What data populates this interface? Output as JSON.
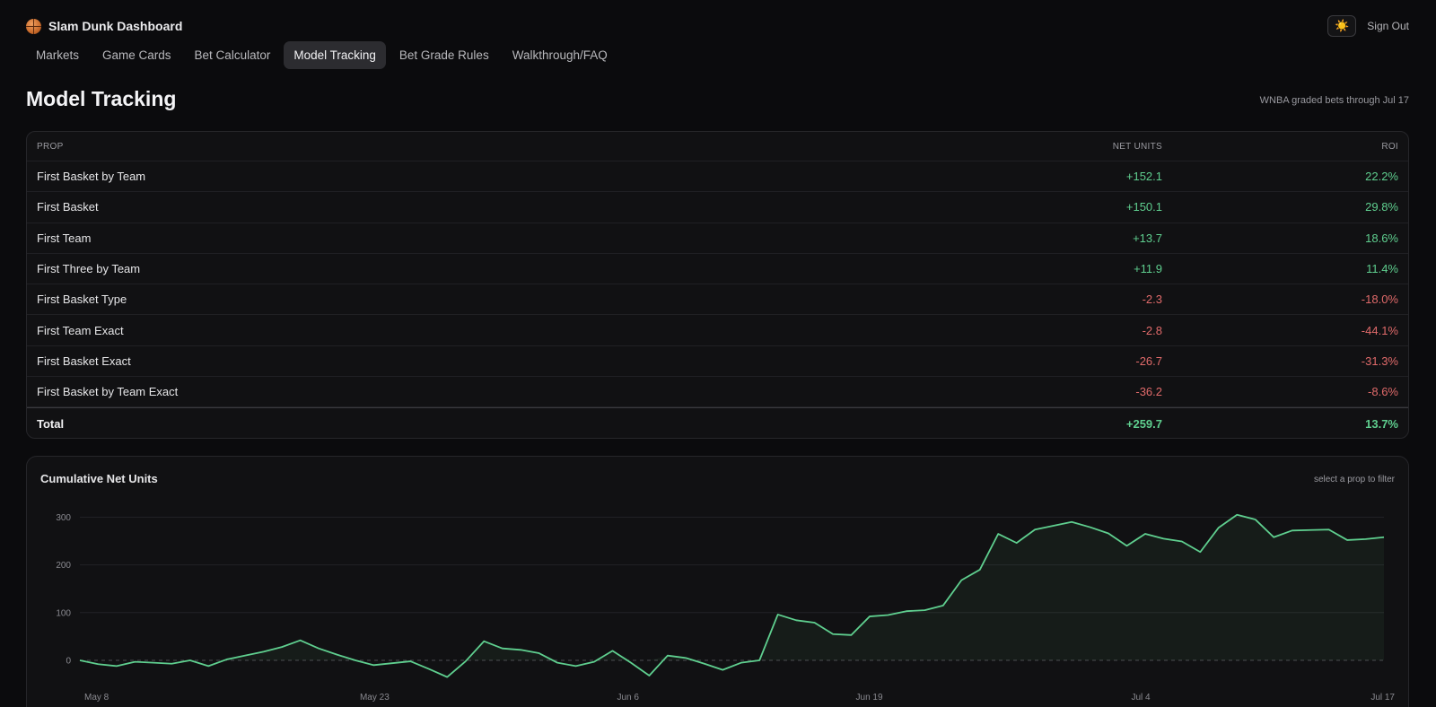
{
  "app": {
    "title": "Slam Dunk Dashboard",
    "logo_icon": "basketball-icon"
  },
  "header": {
    "theme_toggle_icon": "sun-icon",
    "theme_toggle_glyph": "☀️",
    "signout_label": "Sign Out"
  },
  "nav": {
    "items": [
      {
        "label": "Markets"
      },
      {
        "label": "Game Cards"
      },
      {
        "label": "Bet Calculator"
      },
      {
        "label": "Model Tracking",
        "active": true
      },
      {
        "label": "Bet Grade Rules"
      },
      {
        "label": "Walkthrough/FAQ"
      }
    ]
  },
  "page": {
    "title": "Model Tracking",
    "subtitle": "WNBA graded bets through Jul 17"
  },
  "table": {
    "headers": {
      "prop": "PROP",
      "units": "NET UNITS",
      "roi": "ROI"
    },
    "rows": [
      {
        "prop": "First Basket by Team",
        "units": "+152.1",
        "roi": "22.2%"
      },
      {
        "prop": "First Basket",
        "units": "+150.1",
        "roi": "29.8%"
      },
      {
        "prop": "First Team",
        "units": "+13.7",
        "roi": "18.6%"
      },
      {
        "prop": "First Three by Team",
        "units": "+11.9",
        "roi": "11.4%"
      },
      {
        "prop": "First Basket Type",
        "units": "-2.3",
        "roi": "-18.0%"
      },
      {
        "prop": "First Team Exact",
        "units": "-2.8",
        "roi": "-44.1%"
      },
      {
        "prop": "First Basket Exact",
        "units": "-26.7",
        "roi": "-31.3%"
      },
      {
        "prop": "First Basket by Team Exact",
        "units": "-36.2",
        "roi": "-8.6%"
      }
    ],
    "total": {
      "prop": "Total",
      "units": "+259.7",
      "roi": "13.7%"
    }
  },
  "colors": {
    "positive": "#5fcf8f",
    "negative": "#e06a6a",
    "line": "#5fcf8f"
  },
  "chart": {
    "title": "Cumulative Net Units",
    "hint": "select a prop to filter"
  },
  "chart_data": {
    "type": "area",
    "title": "Cumulative Net Units",
    "xlabel": "",
    "ylabel": "",
    "ylim": [
      -40,
      320
    ],
    "yticks": [
      0,
      100,
      200,
      300
    ],
    "xtick_labels": [
      "May 8",
      "May 23",
      "Jun 6",
      "Jun 19",
      "Jul 4",
      "Jul 17"
    ],
    "xtick_index": [
      0,
      15,
      29,
      42,
      57,
      71
    ],
    "grid": true,
    "zero_line": "dashed",
    "series": [
      {
        "values": [
          0,
          -8,
          -12,
          -3,
          -5,
          -7,
          0,
          -12,
          2,
          10,
          18,
          28,
          42,
          25,
          12,
          0,
          -10,
          -6,
          -2,
          -18,
          -35,
          -2,
          40,
          25,
          22,
          15,
          -5,
          -12,
          -3,
          20,
          -5,
          -32,
          10,
          5,
          -7,
          -20,
          -5,
          0,
          96,
          84,
          79,
          55,
          53,
          92,
          95,
          103,
          105,
          115,
          168,
          190,
          265,
          246,
          274,
          282,
          290,
          279,
          266,
          240,
          265,
          255,
          249,
          227,
          278,
          305,
          295,
          258,
          272,
          273,
          274,
          252,
          254,
          258
        ]
      }
    ]
  }
}
